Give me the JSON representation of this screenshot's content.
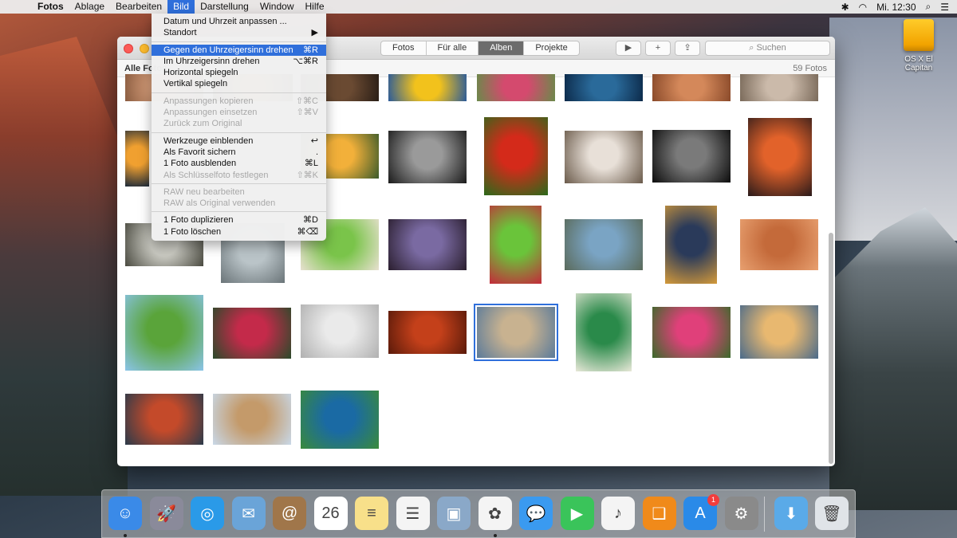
{
  "menubar": {
    "app": "Fotos",
    "items": [
      "Ablage",
      "Bearbeiten",
      "Bild",
      "Darstellung",
      "Window",
      "Hilfe"
    ],
    "active": "Bild",
    "clock": "Mi. 12:30"
  },
  "desktop": {
    "disk_label": "OS X El Capitan"
  },
  "window": {
    "tabs": [
      {
        "label": "Fotos",
        "selected": false
      },
      {
        "label": "Für alle",
        "selected": false
      },
      {
        "label": "Alben",
        "selected": true
      },
      {
        "label": "Projekte",
        "selected": false
      }
    ],
    "search_placeholder": "Suchen",
    "album_title": "Alle Fotos",
    "photo_count": "59 Fotos"
  },
  "bild_menu": {
    "items": [
      {
        "label": "Datum und Uhrzeit anpassen ...",
        "shortcut": "",
        "disabled": false
      },
      {
        "label": "Standort",
        "shortcut": "▶",
        "disabled": false
      },
      "sep",
      {
        "label": "Gegen den Uhrzeigersinn drehen",
        "shortcut": "⌘R",
        "disabled": false,
        "highlight": true
      },
      {
        "label": "Im Uhrzeigersinn drehen",
        "shortcut": "⌥⌘R",
        "disabled": false
      },
      {
        "label": "Horizontal spiegeln",
        "shortcut": "",
        "disabled": false
      },
      {
        "label": "Vertikal spiegeln",
        "shortcut": "",
        "disabled": false
      },
      "sep",
      {
        "label": "Anpassungen kopieren",
        "shortcut": "⇧⌘C",
        "disabled": true
      },
      {
        "label": "Anpassungen einsetzen",
        "shortcut": "⇧⌘V",
        "disabled": true
      },
      {
        "label": "Zurück zum Original",
        "shortcut": "",
        "disabled": true
      },
      "sep",
      {
        "label": "Werkzeuge einblenden",
        "shortcut": "↩",
        "disabled": false
      },
      {
        "label": "Als Favorit sichern",
        "shortcut": ".",
        "disabled": false
      },
      {
        "label": "1 Foto ausblenden",
        "shortcut": "⌘L",
        "disabled": false
      },
      {
        "label": "Als Schlüsselfoto festlegen",
        "shortcut": "⇧⌘K",
        "disabled": true
      },
      "sep",
      {
        "label": "RAW neu bearbeiten",
        "shortcut": "",
        "disabled": true
      },
      {
        "label": "RAW als Original verwenden",
        "shortcut": "",
        "disabled": true
      },
      "sep",
      {
        "label": "1 Foto duplizieren",
        "shortcut": "⌘D",
        "disabled": false
      },
      {
        "label": "1 Foto löschen",
        "shortcut": "⌘⌫",
        "disabled": false
      }
    ]
  },
  "photos": [
    {
      "name": "photo-partial-face",
      "colors": [
        "#d9a07c",
        "#8a5c40"
      ]
    },
    {
      "name": "photo-sunset-road",
      "colors": [
        "#d69a52",
        "#3c2a1e"
      ]
    },
    {
      "name": "photo-railway-bridge",
      "colors": [
        "#6a4a32",
        "#2a1e16"
      ]
    },
    {
      "name": "photo-yellow-flower",
      "colors": [
        "#f2c21c",
        "#2a5a9a"
      ]
    },
    {
      "name": "photo-pink-protea",
      "colors": [
        "#d44a6e",
        "#6a8a4a"
      ]
    },
    {
      "name": "photo-water-drops",
      "colors": [
        "#2a6a9a",
        "#0c2a4a"
      ]
    },
    {
      "name": "photo-old-woman",
      "colors": [
        "#d4885a",
        "#8a4a2a"
      ]
    },
    {
      "name": "photo-laptop-desk",
      "colors": [
        "#cbbaaa",
        "#7a6a5a"
      ]
    },
    {
      "name": "photo-sunset-trees",
      "colors": [
        "#f0a030",
        "#1c2a3a"
      ]
    },
    {
      "name": "photo-sunrise-field",
      "colors": [
        "#f2b03a",
        "#3a5a2a"
      ]
    },
    {
      "name": "photo-old-man-bw",
      "colors": [
        "#9a9a9a",
        "#1a1a1a"
      ]
    },
    {
      "name": "photo-red-parrot",
      "colors": [
        "#d42a1a",
        "#2a6a1a"
      ]
    },
    {
      "name": "photo-swan",
      "colors": [
        "#e8e0d8",
        "#6a5a4a"
      ]
    },
    {
      "name": "photo-man-portrait-bw",
      "colors": [
        "#7a7a7a",
        "#0c0c0c"
      ]
    },
    {
      "name": "photo-lava-sky",
      "colors": [
        "#e2622a",
        "#2a1a1a"
      ]
    },
    {
      "name": "photo-forest-road",
      "colors": [
        "#c8c8c0",
        "#4a4a40"
      ]
    },
    {
      "name": "photo-car-interior",
      "colors": [
        "#bac4c8",
        "#6a7478"
      ]
    },
    {
      "name": "photo-celery",
      "colors": [
        "#7ac44a",
        "#e8e0d0"
      ]
    },
    {
      "name": "photo-cathedral-storm",
      "colors": [
        "#7a6aa2",
        "#2a1e2e"
      ]
    },
    {
      "name": "photo-green-flower",
      "colors": [
        "#6ac43a",
        "#c42a3a"
      ]
    },
    {
      "name": "photo-miniature-town",
      "colors": [
        "#7aa4c4",
        "#5a6a5a"
      ]
    },
    {
      "name": "photo-city-night",
      "colors": [
        "#2a3a5a",
        "#d49a3a"
      ]
    },
    {
      "name": "photo-snake-hand",
      "colors": [
        "#c46a3a",
        "#e8a070"
      ]
    },
    {
      "name": "photo-wheat-field",
      "colors": [
        "#5aa43a",
        "#8ac4e8"
      ]
    },
    {
      "name": "photo-red-flower",
      "colors": [
        "#c42a4a",
        "#2a4a2a"
      ]
    },
    {
      "name": "photo-keyboard",
      "colors": [
        "#eaeaea",
        "#b0b0b0"
      ]
    },
    {
      "name": "photo-red-leaves",
      "colors": [
        "#c4401a",
        "#5a1a0a"
      ]
    },
    {
      "name": "photo-beach-runners",
      "colors": [
        "#c8b290",
        "#5a7a9a"
      ]
    },
    {
      "name": "photo-tea-tins",
      "colors": [
        "#2a8a4a",
        "#e8e8d8"
      ]
    },
    {
      "name": "photo-pink-dahlia",
      "colors": [
        "#e0407a",
        "#3a6a2a"
      ]
    },
    {
      "name": "photo-misty-mountains",
      "colors": [
        "#e8b870",
        "#4a6a8a"
      ]
    },
    {
      "name": "photo-market-fish",
      "colors": [
        "#c44a2a",
        "#2a3a4a"
      ]
    },
    {
      "name": "photo-giraffes",
      "colors": [
        "#c49a6a",
        "#c8d8e8"
      ]
    },
    {
      "name": "photo-peacock",
      "colors": [
        "#1a6aa4",
        "#3a8a3a"
      ]
    }
  ],
  "dock": {
    "items": [
      {
        "name": "finder",
        "glyph": "☺",
        "color": "#3a8ae8",
        "running": true
      },
      {
        "name": "launchpad",
        "glyph": "🚀",
        "color": "#8a8a9a",
        "running": false
      },
      {
        "name": "safari",
        "glyph": "◎",
        "color": "#2a9ae8",
        "running": false
      },
      {
        "name": "mail",
        "glyph": "✉",
        "color": "#6aa4d8",
        "running": false
      },
      {
        "name": "contacts",
        "glyph": "@",
        "color": "#a0764a",
        "running": false
      },
      {
        "name": "calendar",
        "glyph": "26",
        "color": "#ffffff",
        "running": false
      },
      {
        "name": "notes",
        "glyph": "≡",
        "color": "#f8e08a",
        "running": false
      },
      {
        "name": "reminders",
        "glyph": "☰",
        "color": "#f4f4f4",
        "running": false
      },
      {
        "name": "preview",
        "glyph": "▣",
        "color": "#8aa8c8",
        "running": false
      },
      {
        "name": "photos",
        "glyph": "✿",
        "color": "#f4f4f4",
        "running": true
      },
      {
        "name": "messages",
        "glyph": "💬",
        "color": "#3a9af0",
        "running": false
      },
      {
        "name": "facetime",
        "glyph": "▶",
        "color": "#3ac45a",
        "running": false
      },
      {
        "name": "itunes",
        "glyph": "♪",
        "color": "#f4f4f4",
        "running": false
      },
      {
        "name": "ibooks",
        "glyph": "❑",
        "color": "#f08a1a",
        "running": false
      },
      {
        "name": "app-store",
        "glyph": "A",
        "color": "#2a8ae8",
        "running": false,
        "badge": "1"
      },
      {
        "name": "system-preferences",
        "glyph": "⚙",
        "color": "#8a8a8a",
        "running": false
      },
      {
        "name": "downloads",
        "glyph": "⬇",
        "color": "#5aaae8",
        "running": false
      },
      {
        "name": "trash",
        "glyph": "🗑",
        "color": "#e0e4e8",
        "running": false
      }
    ]
  }
}
